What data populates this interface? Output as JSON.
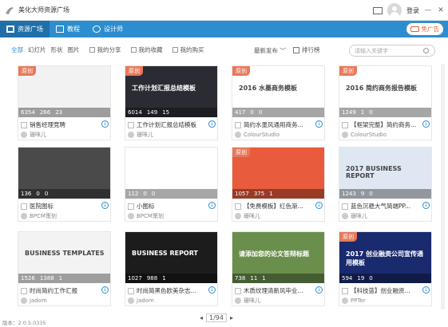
{
  "app": {
    "title": "美化大师资源广场",
    "login": "登录",
    "version": "版本：2.0.5.0335"
  },
  "nav": {
    "tabs": [
      "资源广场",
      "教程",
      "设计师"
    ],
    "ad": "免广告"
  },
  "filters": {
    "types": [
      "全部",
      "幻灯片",
      "形状",
      "图片"
    ],
    "checks": [
      "我的分享",
      "我的收藏",
      "我的购买"
    ],
    "sort": "最新发布 ﹀",
    "rank": "排行榜",
    "search_placeholder": "请输入关键字"
  },
  "cards": [
    {
      "title": "销售经理竞聘",
      "author": "珊咪儿",
      "views": "6354",
      "likes": "266",
      "comments": "23",
      "badge": "原创",
      "thumb": "#f2f2f2"
    },
    {
      "title": "工作计划汇报总结模板",
      "author": "珊咪儿",
      "views": "6014",
      "likes": "149",
      "comments": "15",
      "badge": "原创",
      "thumb": "#2b2b33"
    },
    {
      "title": "简约水墨风通用商务...",
      "author": "ColourStudio",
      "views": "417",
      "likes": "0",
      "comments": "0",
      "badge": "原创",
      "thumb": "#ffffff"
    },
    {
      "title": "【框架完整】简约商务...",
      "author": "ColourStudio",
      "views": "1249",
      "likes": "1",
      "comments": "0",
      "badge": "原创",
      "thumb": "#ffffff"
    },
    {
      "title": "医院图标",
      "author": "BPCM策划",
      "views": "136",
      "likes": "0",
      "comments": "0",
      "badge": "",
      "thumb": "#4a4a4a"
    },
    {
      "title": "小图标",
      "author": "BPCM策划",
      "views": "112",
      "likes": "0",
      "comments": "0",
      "badge": "",
      "thumb": "#ffffff"
    },
    {
      "title": "【免费模板】红色渐...",
      "author": "珊咪儿",
      "views": "1057",
      "likes": "375",
      "comments": "1",
      "badge": "原创",
      "thumb": "#e85b3c"
    },
    {
      "title": "蓝色沉稳大气简端PP...",
      "author": "珊咪儿",
      "views": "1243",
      "likes": "9",
      "comments": "0",
      "badge": "",
      "thumb": "#dfe8f2"
    },
    {
      "title": "时尚简约工作汇报",
      "author": "jadom",
      "views": "1526",
      "likes": "1388",
      "comments": "1",
      "badge": "",
      "thumb": "#f3f3f3"
    },
    {
      "title": "时尚简黑色欧美杂志...",
      "author": "jadom",
      "views": "1027",
      "likes": "988",
      "comments": "1",
      "badge": "",
      "thumb": "#1c1c1c"
    },
    {
      "title": "木质纹理清新风毕业...",
      "author": "珊咪儿",
      "views": "738",
      "likes": "11",
      "comments": "1",
      "badge": "",
      "thumb": "#6a8f4d"
    },
    {
      "title": "【科技蓝】创业融资...",
      "author": "PPTer",
      "views": "594",
      "likes": "19",
      "comments": "0",
      "badge": "原创",
      "thumb": "#1a2a6e"
    }
  ],
  "thumb_texts": [
    "",
    "工作计划汇报总结模板",
    "2016 水墨商务模板",
    "2016 简约商务报告模板",
    "",
    "",
    "",
    "2017 BUSINESS REPORT",
    "BUSINESS TEMPLATES",
    "BUSINESS REPORT",
    "请添加您的论文答辩标题",
    "2017 创业融资公司宣传通用模板"
  ],
  "pager": {
    "text": "1/94"
  }
}
